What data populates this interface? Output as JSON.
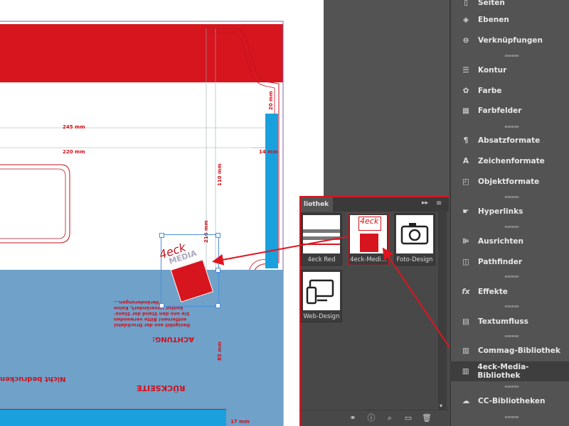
{
  "panel": {
    "items": [
      {
        "label": "Seiten",
        "icon": "pages-icon"
      },
      {
        "label": "Ebenen",
        "icon": "layers-icon"
      },
      {
        "label": "Verknüpfungen",
        "icon": "links-icon"
      },
      {
        "label": "Kontur",
        "icon": "stroke-icon"
      },
      {
        "label": "Farbe",
        "icon": "color-palette-icon"
      },
      {
        "label": "Farbfelder",
        "icon": "swatches-icon"
      },
      {
        "label": "Absatzformate",
        "icon": "paragraph-styles-icon"
      },
      {
        "label": "Zeichenformate",
        "icon": "character-styles-icon"
      },
      {
        "label": "Objektformate",
        "icon": "object-styles-icon"
      },
      {
        "label": "Hyperlinks",
        "icon": "hyperlinks-icon"
      },
      {
        "label": "Ausrichten",
        "icon": "align-icon"
      },
      {
        "label": "Pathfinder",
        "icon": "pathfinder-icon"
      },
      {
        "label": "Effekte",
        "icon": "effects-icon"
      },
      {
        "label": "Textumfluss",
        "icon": "text-wrap-icon"
      },
      {
        "label": "Commag-Bibliothek",
        "icon": "library-icon"
      },
      {
        "label": "4eck-Media-Bibliothek",
        "icon": "library-icon"
      },
      {
        "label": "CC-Bibliotheken",
        "icon": "creative-cloud-icon"
      }
    ],
    "selected_index": 15
  },
  "library": {
    "tab_label": "liothek",
    "items": [
      {
        "label": "4eck Red"
      },
      {
        "label": "4eck-Medi..."
      },
      {
        "label": "Foto-Design"
      },
      {
        "label": "Web-Design"
      }
    ],
    "logo_text": "4eck",
    "logo_sub": "MEDIA"
  },
  "canvas": {
    "dims": {
      "d245": "245 mm",
      "d220": "220 mm",
      "d110": "110 mm",
      "d216": "216 mm",
      "d85": "85 mm",
      "d14": "14 mm",
      "d17": "17 mm",
      "d20": "20 mm"
    },
    "back_title": "RÜCKSEITE",
    "warning_title": "ACHTUNG:",
    "warning_lines": [
      "Designbit aus der Druckdatei",
      "entfernen! Bitte verwenden",
      "Sie uns den Stand der Stanz-",
      "kontur unverändert, Keine",
      "Veränderungen..."
    ],
    "no_print": "Nicht bedrucken",
    "placed_logo_text": "4eck",
    "placed_logo_sub": "MEDIA"
  },
  "colors": {
    "red": "#d6151f",
    "blue_band": "#6fa1c9",
    "cyan_bar": "#1aa0dc",
    "panel_bg": "#535353"
  }
}
